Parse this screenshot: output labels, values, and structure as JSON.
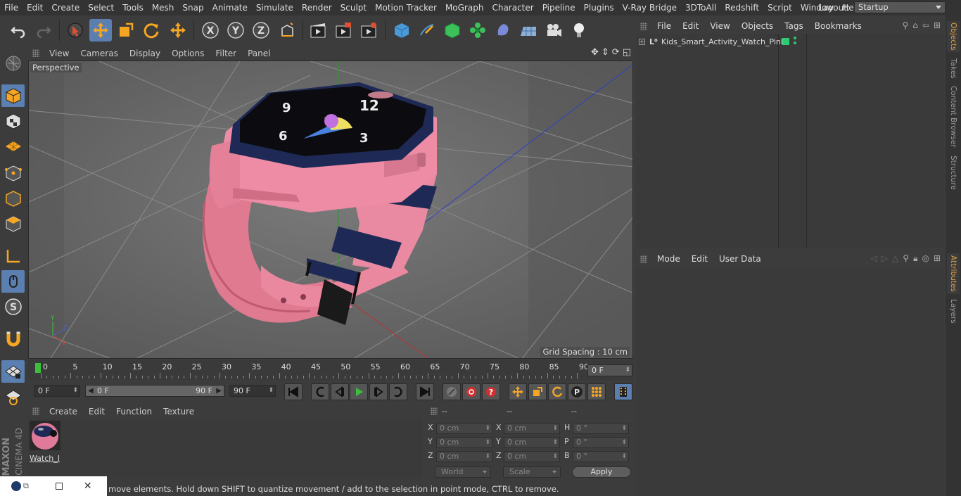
{
  "menubar": {
    "items": [
      "File",
      "Edit",
      "Create",
      "Select",
      "Tools",
      "Mesh",
      "Snap",
      "Animate",
      "Simulate",
      "Render",
      "Sculpt",
      "Motion Tracker",
      "MoGraph",
      "Character",
      "Pipeline",
      "Plugins",
      "V-Ray Bridge",
      "3DToAll",
      "Redshift",
      "Script",
      "Window",
      "Help"
    ],
    "layout_label": "Layout:",
    "layout_value": "Startup"
  },
  "toolbar": {
    "tools": [
      {
        "name": "undo-icon"
      },
      {
        "name": "redo-icon"
      },
      {
        "name": "live-selection-icon",
        "active": false
      },
      {
        "name": "move-icon",
        "active": true
      },
      {
        "name": "scale-icon"
      },
      {
        "name": "rotate-icon"
      },
      {
        "name": "transform-icon"
      },
      {
        "name": "x-axis-icon",
        "label": "X"
      },
      {
        "name": "y-axis-icon",
        "label": "Y"
      },
      {
        "name": "z-axis-icon",
        "label": "Z"
      },
      {
        "name": "coordinate-system-icon"
      },
      {
        "name": "render-view-icon"
      },
      {
        "name": "render-to-picture-viewer-icon"
      },
      {
        "name": "render-settings-icon"
      },
      {
        "name": "cube-icon"
      },
      {
        "name": "pen-icon"
      },
      {
        "name": "subdivision-icon"
      },
      {
        "name": "cloner-icon"
      },
      {
        "name": "deformer-icon"
      },
      {
        "name": "floor-icon"
      },
      {
        "name": "camera-icon"
      },
      {
        "name": "light-icon"
      }
    ]
  },
  "left_tools": [
    "make-editable-icon",
    "model-mode-icon",
    "texture-mode-icon",
    "workplane-icon",
    "points-mode-icon",
    "edges-mode-icon",
    "polygons-mode-icon",
    "axis-icon",
    "tweak-icon",
    "solo-icon",
    "snap-icon",
    "grid-lock-icon",
    "paint-icon"
  ],
  "viewport": {
    "menu": [
      "View",
      "Cameras",
      "Display",
      "Options",
      "Filter",
      "Panel"
    ],
    "label": "Perspective",
    "grid_spacing": "Grid Spacing : 10 cm",
    "object": "Kids Smart Activity Watch (pink)",
    "watch_face_numbers": [
      "12",
      "9",
      "3",
      "6"
    ]
  },
  "timeline": {
    "ticks": [
      "0",
      "5",
      "10",
      "15",
      "20",
      "25",
      "30",
      "35",
      "40",
      "45",
      "50",
      "55",
      "60",
      "65",
      "70",
      "75",
      "80",
      "85",
      "90"
    ],
    "current_frame_field": "0 F"
  },
  "transport": {
    "start_field": "0 F",
    "range_start": "0 F",
    "range_end": "90 F",
    "end_field": "90 F"
  },
  "material_panel": {
    "menu": [
      "Create",
      "Edit",
      "Function",
      "Texture"
    ],
    "materials": [
      {
        "name": "Watch_I"
      }
    ]
  },
  "coordinates": {
    "col_headers": [
      "--",
      "--",
      "--"
    ],
    "rows": [
      {
        "l1": "X",
        "v1": "0 cm",
        "l2": "X",
        "v2": "0 cm",
        "l3": "H",
        "v3": "0 °"
      },
      {
        "l1": "Y",
        "v1": "0 cm",
        "l2": "Y",
        "v2": "0 cm",
        "l3": "P",
        "v3": "0 °"
      },
      {
        "l1": "Z",
        "v1": "0 cm",
        "l2": "Z",
        "v2": "0 cm",
        "l3": "B",
        "v3": "0 °"
      }
    ],
    "world_select": "World",
    "scale_select": "Scale",
    "apply_label": "Apply"
  },
  "objects_panel": {
    "menu": [
      "File",
      "Edit",
      "View",
      "Objects",
      "Tags",
      "Bookmarks"
    ],
    "items": [
      {
        "name": "Kids_Smart_Activity_Watch_Pink",
        "color": "#2ecc71"
      }
    ]
  },
  "attributes_panel": {
    "menu": [
      "Mode",
      "Edit",
      "User Data"
    ]
  },
  "right_tabs": [
    {
      "label": "Objects",
      "active": true
    },
    {
      "label": "Takes",
      "active": false
    },
    {
      "label": "Content Browser",
      "active": false
    },
    {
      "label": "Structure",
      "active": false
    },
    {
      "label": "Attributes",
      "active": true
    },
    {
      "label": "Layers",
      "active": false
    }
  ],
  "statusbar": {
    "text": "move elements. Hold down SHIFT to quantize movement / add to the selection in point mode, CTRL to remove."
  },
  "branding": {
    "maxon": "MAXON",
    "product": "CINEMA 4D"
  },
  "colors": {
    "accent": "#5a7fb0",
    "active_tab": "#e0a040",
    "watch_pink": "#e8849a",
    "watch_navy": "#1e2a55"
  }
}
